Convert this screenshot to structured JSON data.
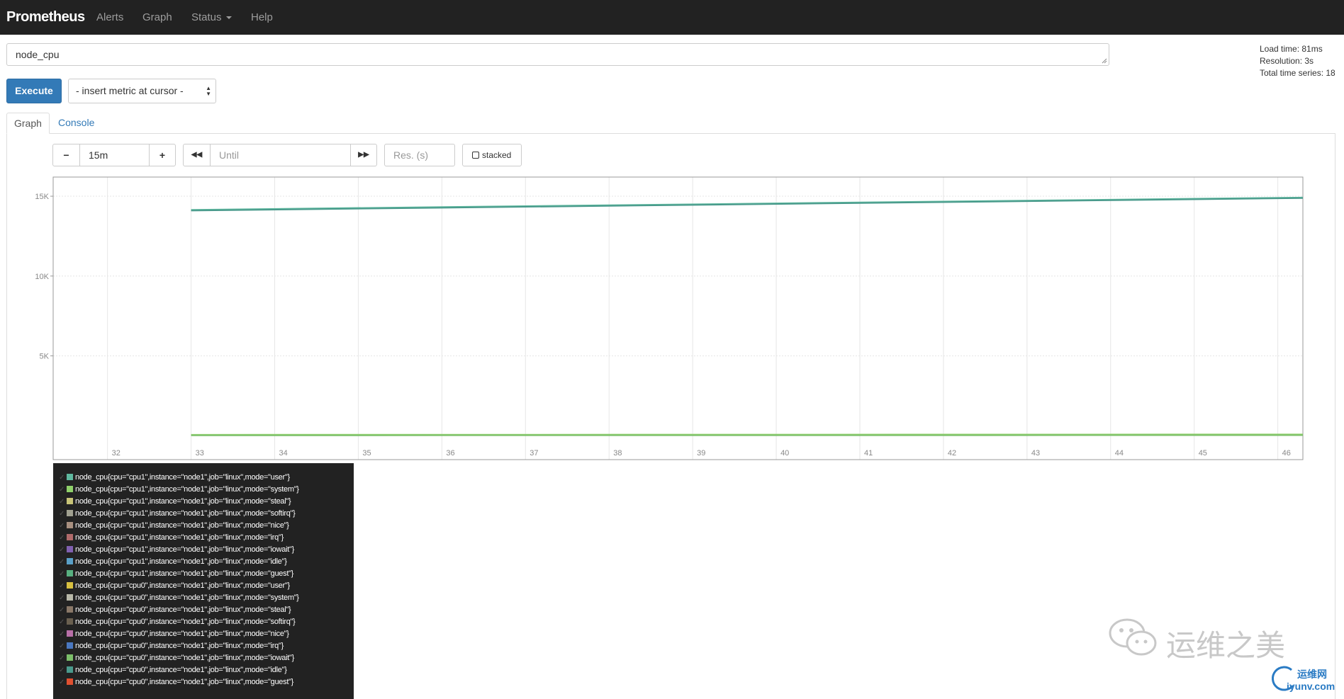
{
  "navbar": {
    "brand": "Prometheus",
    "links": [
      "Alerts",
      "Graph",
      "Status",
      "Help"
    ]
  },
  "expression": {
    "value": "node_cpu"
  },
  "stats": {
    "load_time": "Load time: 81ms",
    "resolution": "Resolution: 3s",
    "total_series": "Total time series: 18"
  },
  "toolbar": {
    "execute_label": "Execute",
    "metric_select": "- insert metric at cursor -"
  },
  "tabs": [
    "Graph",
    "Console"
  ],
  "graph_controls": {
    "minus": "−",
    "range": "15m",
    "plus": "+",
    "back": "◀◀",
    "until_placeholder": "Until",
    "forward": "▶▶",
    "res_placeholder": "Res. (s)",
    "stacked_label": "stacked"
  },
  "chart_data": {
    "type": "line",
    "x_ticks": [
      "32",
      "33",
      "34",
      "35",
      "36",
      "37",
      "38",
      "39",
      "40",
      "41",
      "42",
      "43",
      "44",
      "45",
      "46"
    ],
    "y_ticks": [
      "5K",
      "10K",
      "15K"
    ],
    "xlim": [
      31.35,
      46.3
    ],
    "ylim": [
      -1500,
      16200
    ],
    "series": [
      {
        "name": "node_cpu{cpu=\"cpu1\",instance=\"node1\",job=\"linux\",mode=\"user\"}",
        "color": "#5fb99f",
        "x": [
          33,
          46.3
        ],
        "y": [
          14150,
          14920
        ]
      },
      {
        "name": "node_cpu{cpu=\"cpu0\",instance=\"node1\",job=\"linux\",mode=\"idle\"}",
        "color": "#4a9a8c",
        "x": [
          33,
          46.3
        ],
        "y": [
          14100,
          14880
        ]
      },
      {
        "name": "node_cpu{cpu=\"cpu1\",instance=\"node1\",job=\"linux\",mode=\"system\"}",
        "color": "#8fd16a",
        "x": [
          33,
          46.3
        ],
        "y": [
          60,
          80
        ]
      },
      {
        "name": "node_cpu{cpu=\"cpu0\",instance=\"node1\",job=\"linux\",mode=\"iowait\"}",
        "color": "#7cbf6a",
        "x": [
          33,
          46.3
        ],
        "y": [
          20,
          30
        ]
      }
    ]
  },
  "legend": [
    {
      "label": "node_cpu{cpu=\"cpu1\",instance=\"node1\",job=\"linux\",mode=\"user\"}",
      "color": "#5fb99f"
    },
    {
      "label": "node_cpu{cpu=\"cpu1\",instance=\"node1\",job=\"linux\",mode=\"system\"}",
      "color": "#8fd16a"
    },
    {
      "label": "node_cpu{cpu=\"cpu1\",instance=\"node1\",job=\"linux\",mode=\"steal\"}",
      "color": "#c8c478"
    },
    {
      "label": "node_cpu{cpu=\"cpu1\",instance=\"node1\",job=\"linux\",mode=\"softirq\"}",
      "color": "#a0a090"
    },
    {
      "label": "node_cpu{cpu=\"cpu1\",instance=\"node1\",job=\"linux\",mode=\"nice\"}",
      "color": "#a89080"
    },
    {
      "label": "node_cpu{cpu=\"cpu1\",instance=\"node1\",job=\"linux\",mode=\"irq\"}",
      "color": "#b06a6a"
    },
    {
      "label": "node_cpu{cpu=\"cpu1\",instance=\"node1\",job=\"linux\",mode=\"iowait\"}",
      "color": "#8060b0"
    },
    {
      "label": "node_cpu{cpu=\"cpu1\",instance=\"node1\",job=\"linux\",mode=\"idle\"}",
      "color": "#5aa0c8"
    },
    {
      "label": "node_cpu{cpu=\"cpu1\",instance=\"node1\",job=\"linux\",mode=\"guest\"}",
      "color": "#58b080"
    },
    {
      "label": "node_cpu{cpu=\"cpu0\",instance=\"node1\",job=\"linux\",mode=\"user\"}",
      "color": "#d8c040"
    },
    {
      "label": "node_cpu{cpu=\"cpu0\",instance=\"node1\",job=\"linux\",mode=\"system\"}",
      "color": "#b8b8a8"
    },
    {
      "label": "node_cpu{cpu=\"cpu0\",instance=\"node1\",job=\"linux\",mode=\"steal\"}",
      "color": "#8a7868"
    },
    {
      "label": "node_cpu{cpu=\"cpu0\",instance=\"node1\",job=\"linux\",mode=\"softirq\"}",
      "color": "#6a6050"
    },
    {
      "label": "node_cpu{cpu=\"cpu0\",instance=\"node1\",job=\"linux\",mode=\"nice\"}",
      "color": "#b870a8"
    },
    {
      "label": "node_cpu{cpu=\"cpu0\",instance=\"node1\",job=\"linux\",mode=\"irq\"}",
      "color": "#4a78c0"
    },
    {
      "label": "node_cpu{cpu=\"cpu0\",instance=\"node1\",job=\"linux\",mode=\"iowait\"}",
      "color": "#7cbf6a"
    },
    {
      "label": "node_cpu{cpu=\"cpu0\",instance=\"node1\",job=\"linux\",mode=\"idle\"}",
      "color": "#4a9a8c"
    },
    {
      "label": "node_cpu{cpu=\"cpu0\",instance=\"node1\",job=\"linux\",mode=\"guest\"}",
      "color": "#e05030"
    }
  ],
  "watermark": {
    "text": "运维之美",
    "site_name": "运维网",
    "site_url": "iyunv.com"
  }
}
